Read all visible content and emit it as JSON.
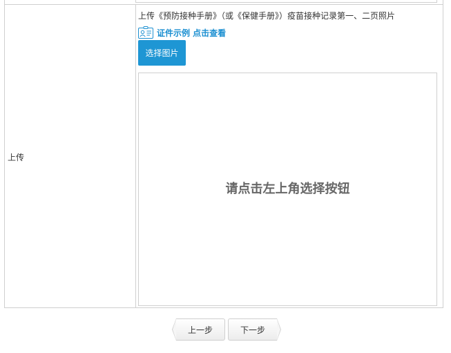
{
  "upload_row": {
    "label": "上传",
    "instruction": "上传《预防接种手册》（或《保健手册》）疫苗接种记录第一、二页照片",
    "example_link": "证件示例 点击查看",
    "choose_button": "选择图片",
    "preview_hint": "请点击左上角选择按钮"
  },
  "navigation": {
    "prev_label": "上一步",
    "next_label": "下一步"
  },
  "colors": {
    "accent": "#1e96d4",
    "link": "#1b8fd1",
    "border": "#cfcfcf"
  },
  "icons": {
    "example": "id-card-icon"
  }
}
